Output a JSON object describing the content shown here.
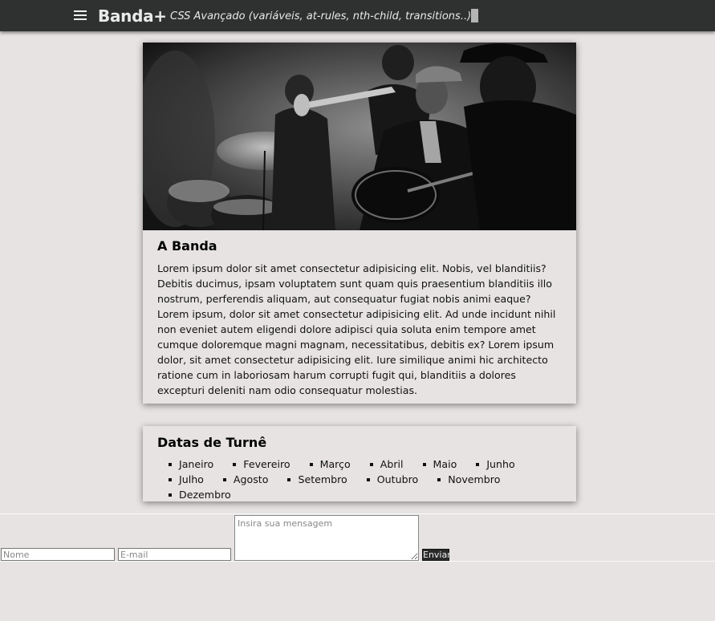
{
  "header": {
    "brand": "Banda+",
    "subtitle": "CSS Avançado (variáveis, at-rules, nth-child, transitions..)",
    "menu_icon": "hamburger-menu-icon"
  },
  "band": {
    "image_alt": "Foto em preto e branco de uma banda de jazz tocando",
    "title": "A Banda",
    "text": "Lorem ipsum dolor sit amet consectetur adipisicing elit. Nobis, vel blanditiis? Debitis ducimus, ipsam voluptatem sunt quam quis praesentium blanditiis illo nostrum, perferendis aliquam, aut consequatur fugiat nobis animi eaque? Lorem ipsum, dolor sit amet consectetur adipisicing elit. Ad unde incidunt nihil non eveniet autem eligendi dolore adipisci quia soluta enim tempore amet cumque doloremque magni magnam, necessitatibus, debitis ex? Lorem ipsum dolor, sit amet consectetur adipisicing elit. Iure similique animi hic architecto ratione cum in laboriosam harum corrupti fugit qui, blanditiis a dolores excepturi deleniti nam odio consequatur molestias."
  },
  "tour": {
    "title": "Datas de Turnê",
    "months": [
      "Janeiro",
      "Fevereiro",
      "Março",
      "Abril",
      "Maio",
      "Junho",
      "Julho",
      "Agosto",
      "Setembro",
      "Outubro",
      "Novembro",
      "Dezembro"
    ]
  },
  "form": {
    "name_placeholder": "Nome",
    "email_placeholder": "E-mail",
    "message_placeholder": "Insira sua mensagem",
    "submit_label": "Enviar"
  },
  "colors": {
    "topbar": "#2f3131",
    "background": "#e6e3e2"
  }
}
